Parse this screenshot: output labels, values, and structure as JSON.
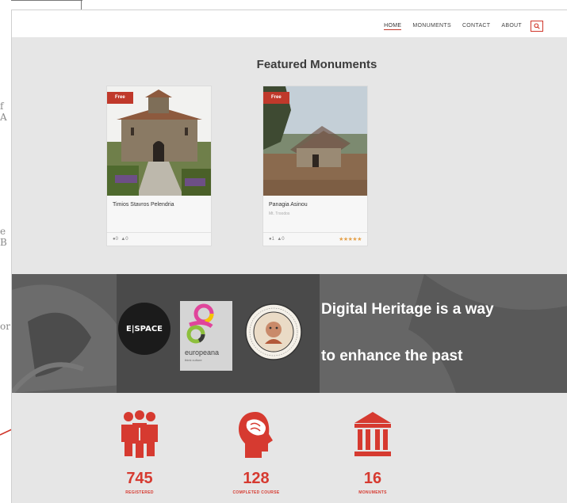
{
  "background_fragments": [
    "f A",
    "e B",
    "or"
  ],
  "nav": {
    "items": [
      "HOME",
      "MONUMENTS",
      "CONTACT",
      "ABOUT"
    ],
    "active": "HOME"
  },
  "featured": {
    "title": "Featured Monuments",
    "cards": [
      {
        "badge": "Free",
        "name": "Timios Stavros Pelendria",
        "subtitle": "",
        "comments": "0",
        "likes": "0",
        "rating_stars": 0
      },
      {
        "badge": "Free",
        "name": "Panagia Asinou",
        "subtitle": "Mt. Troodos",
        "comments": "1",
        "likes": "0",
        "rating_stars": 5
      }
    ]
  },
  "banner": {
    "logo_espace": "E|SPACE",
    "logo_europeana": "europeana",
    "logo_europeana_sub": "think culture",
    "line1": "Digital Heritage is a way",
    "line2": "to enhance the past"
  },
  "stats": [
    {
      "icon": "people-icon",
      "value": "745",
      "label": "REGISTERED"
    },
    {
      "icon": "head-icon",
      "value": "128",
      "label": "COMPLETED COURSE"
    },
    {
      "icon": "monument-icon",
      "value": "16",
      "label": "MONUMENTS"
    }
  ],
  "colors": {
    "accent": "#c0392b",
    "stat_red": "#d63a30",
    "window_bg": "#e6e6e6",
    "banner_bg": "#5f5f5f",
    "star": "#e5a14a"
  }
}
